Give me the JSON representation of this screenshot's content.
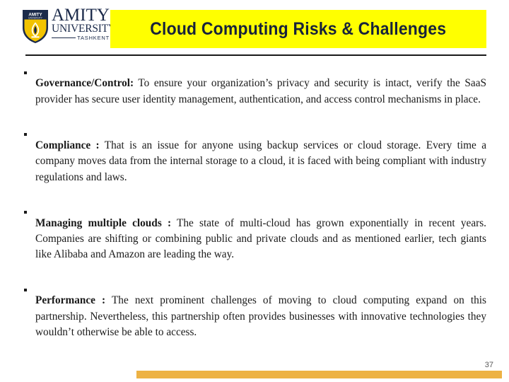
{
  "header": {
    "logo": {
      "name": "amity-university-logo",
      "shield_alt": "shield-with-flame",
      "shield_label_top": "AMITY",
      "shield_label_bottom": "UNIVERSITY",
      "brand_line1": "AMITY",
      "brand_line2": "UNIVERSITY",
      "brand_line3": "TASHKENT",
      "navy": "#1b2a4a",
      "gold": "#f2c300"
    },
    "title": "Cloud Computing Risks & Challenges",
    "title_banner_color": "#ffff00",
    "title_text_color": "#17223b"
  },
  "content": {
    "bullets": [
      {
        "lead": "Governance/Control:",
        "body": " To ensure your organization’s privacy and security is intact, verify the SaaS provider has secure user identity management, authentication, and access control mechanisms in place."
      },
      {
        "lead": "Compliance :",
        "body": " That is an issue for anyone using backup services or cloud storage. Every time a company moves data from the internal storage to a cloud, it is faced with being compliant with industry regulations and laws."
      },
      {
        "lead": " Managing multiple clouds :",
        "body": " The state of multi-cloud has grown exponentially in recent years. Companies are shifting or combining public and private clouds and as mentioned earlier, tech giants like Alibaba and Amazon are leading the way."
      },
      {
        "lead": "Performance :",
        "body": " The next prominent challenges of moving to cloud computing expand on this partnership. Nevertheless, this partnership often provides businesses with innovative technologies they wouldn’t otherwise be able to access."
      }
    ]
  },
  "footer": {
    "page_number": "37",
    "bar_color": "#edb244"
  }
}
